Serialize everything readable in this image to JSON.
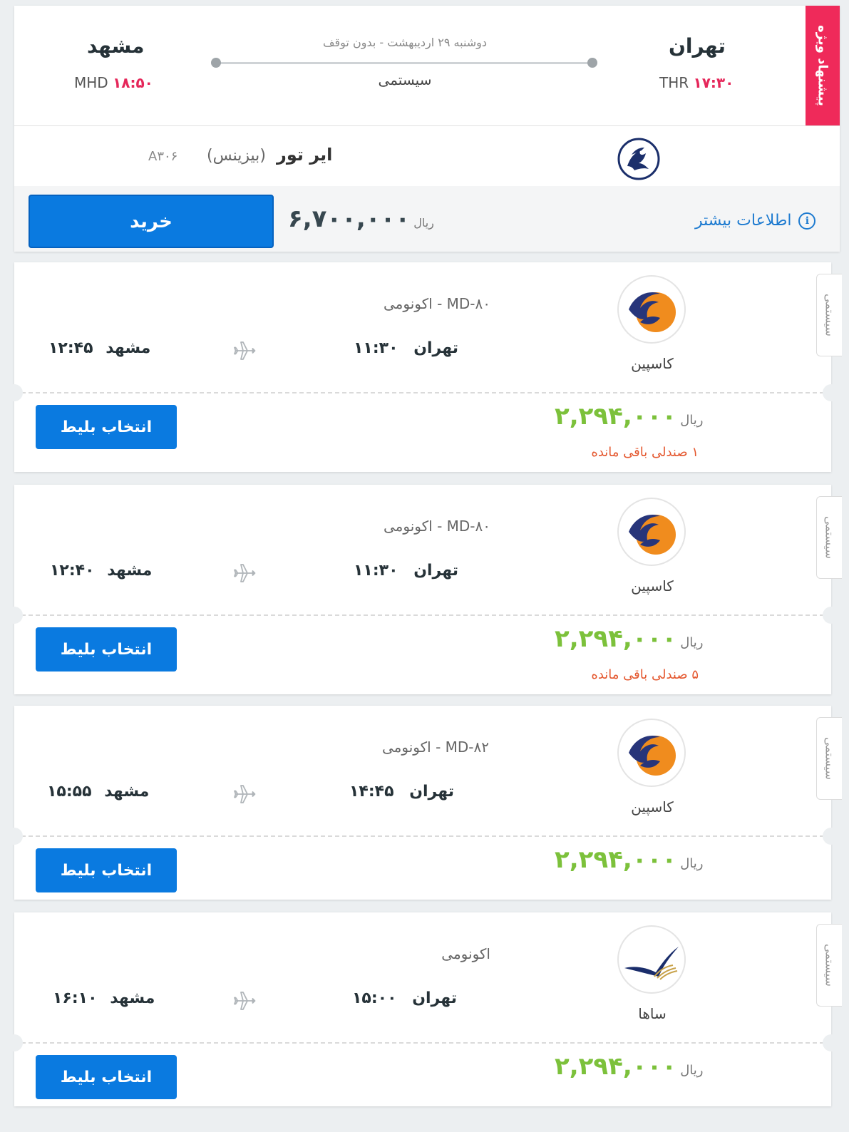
{
  "special_offer": {
    "ribbon": "پیشنهاد ویژه",
    "origin": {
      "city": "تهران",
      "code": "THR",
      "time": "۱۷:۳۰"
    },
    "destination": {
      "city": "مشهد",
      "code": "MHD",
      "time": "۱۸:۵۰"
    },
    "date_info": "دوشنبه ۲۹ اردیبهشت - بدون توقف",
    "type": "سیستمی",
    "airline": "ایر تور",
    "class": "(بیزینس)",
    "flight_number": "A۳۰۶",
    "price": "۶,۷۰۰,۰۰۰",
    "currency": "ریال",
    "buy_label": "خرید",
    "more_info": "اطلاعات بیشتر"
  },
  "flights": [
    {
      "tab": "سیستمی",
      "airline": "کاسپین",
      "aircraft": "MD-۸۰ - اکونومی",
      "origin_city": "تهران",
      "dep_time": "۱۱:۳۰",
      "dest_city": "مشهد",
      "arr_time": "۱۲:۴۵",
      "price": "۲,۲۹۴,۰۰۰",
      "currency": "ریال",
      "seats": "۱ صندلی باقی مانده",
      "select_label": "انتخاب بلیط"
    },
    {
      "tab": "سیستمی",
      "airline": "کاسپین",
      "aircraft": "MD-۸۰ - اکونومی",
      "origin_city": "تهران",
      "dep_time": "۱۱:۳۰",
      "dest_city": "مشهد",
      "arr_time": "۱۲:۴۰",
      "price": "۲,۲۹۴,۰۰۰",
      "currency": "ریال",
      "seats": "۵ صندلی باقی مانده",
      "select_label": "انتخاب بلیط"
    },
    {
      "tab": "سیستمی",
      "airline": "کاسپین",
      "aircraft": "MD-۸۲ - اکونومی",
      "origin_city": "تهران",
      "dep_time": "۱۴:۴۵",
      "dest_city": "مشهد",
      "arr_time": "۱۵:۵۵",
      "price": "۲,۲۹۴,۰۰۰",
      "currency": "ریال",
      "select_label": "انتخاب بلیط"
    },
    {
      "tab": "سیستمی",
      "airline": "ساها",
      "aircraft": "اکونومی",
      "origin_city": "تهران",
      "dep_time": "۱۵:۰۰",
      "dest_city": "مشهد",
      "arr_time": "۱۶:۱۰",
      "price": "۲,۲۹۴,۰۰۰",
      "currency": "ریال",
      "select_label": "انتخاب بلیط"
    }
  ],
  "colors": {
    "accent_blue": "#0a7ae0",
    "ribbon_pink": "#ef2a5a",
    "price_green": "#7cc13b",
    "seats_orange": "#e4572e",
    "time_pink": "#e5275a"
  },
  "icons": [
    "iran-airtour-logo",
    "caspian-logo",
    "saha-logo",
    "plane-icon",
    "info-icon"
  ]
}
